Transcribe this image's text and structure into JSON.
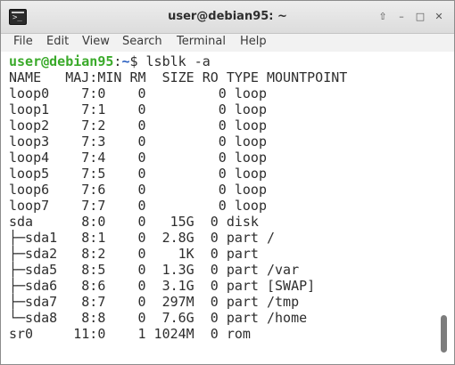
{
  "window": {
    "title": "user@debian95: ~",
    "icon": "terminal-app-icon",
    "controls": [
      "window-up-icon",
      "minimize-icon",
      "maximize-icon",
      "close-icon"
    ]
  },
  "menu": {
    "items": [
      "File",
      "Edit",
      "View",
      "Search",
      "Terminal",
      "Help"
    ]
  },
  "prompt": {
    "user_host": "user@debian95",
    "separator": ":",
    "path": "~",
    "symbol": "$",
    "command": "lsblk -a"
  },
  "output": {
    "header": "NAME   MAJ:MIN RM  SIZE RO TYPE MOUNTPOINT",
    "lines": [
      "loop0    7:0    0         0 loop",
      "loop1    7:1    0         0 loop",
      "loop2    7:2    0         0 loop",
      "loop3    7:3    0         0 loop",
      "loop4    7:4    0         0 loop",
      "loop5    7:5    0         0 loop",
      "loop6    7:6    0         0 loop",
      "loop7    7:7    0         0 loop",
      "sda      8:0    0   15G  0 disk",
      "├─sda1   8:1    0  2.8G  0 part /",
      "├─sda2   8:2    0    1K  0 part",
      "├─sda5   8:5    0  1.3G  0 part /var",
      "├─sda6   8:6    0  3.1G  0 part [SWAP]",
      "├─sda7   8:7    0  297M  0 part /tmp",
      "└─sda8   8:8    0  7.6G  0 part /home",
      "sr0     11:0    1 1024M  0 rom"
    ]
  },
  "colors": {
    "prompt_user": "#3aaa2a",
    "prompt_path": "#2a5fc1",
    "text": "#2e2e2e"
  }
}
